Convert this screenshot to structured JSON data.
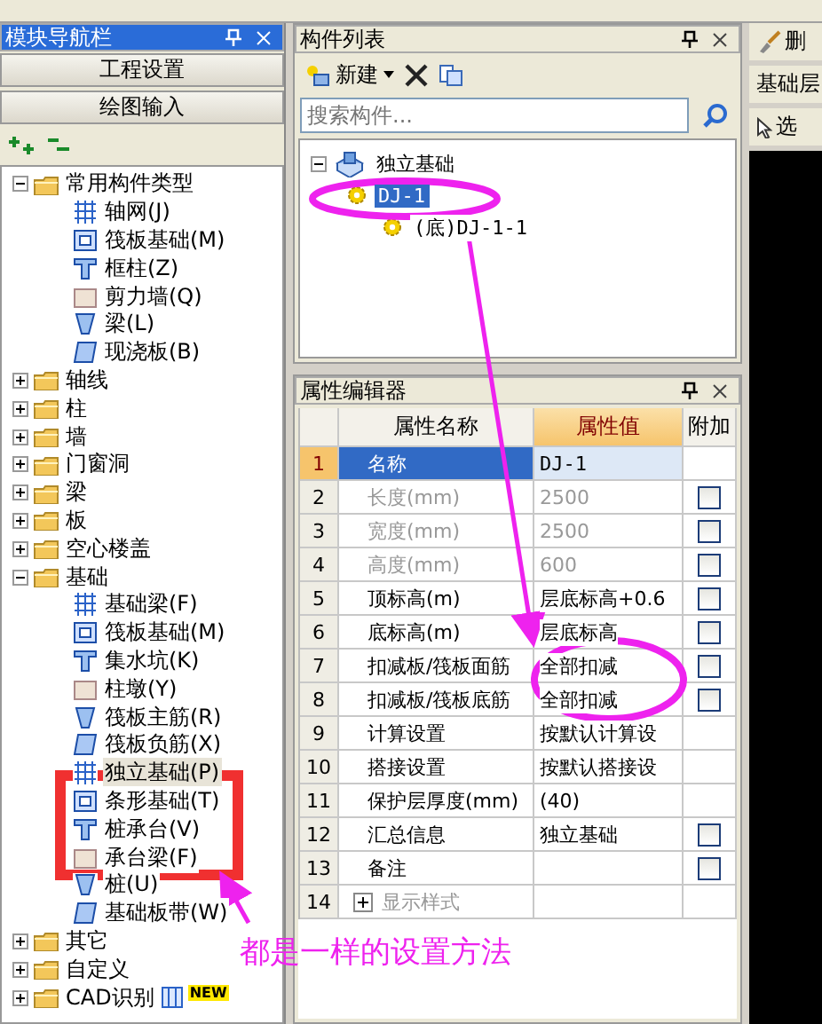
{
  "nav_panel": {
    "title": "模块导航栏",
    "buttons": [
      "工程设置",
      "绘图输入"
    ],
    "tree": [
      {
        "label": "常用构件类型",
        "expanded": true,
        "selected": false,
        "children": [
          {
            "label": "轴网(J)",
            "selected": false
          },
          {
            "label": "筏板基础(M)",
            "selected": false
          },
          {
            "label": "框柱(Z)",
            "selected": false
          },
          {
            "label": "剪力墙(Q)",
            "selected": false
          },
          {
            "label": "梁(L)",
            "selected": false
          },
          {
            "label": "现浇板(B)",
            "selected": false
          }
        ]
      },
      {
        "label": "轴线",
        "expanded": false,
        "selected": false
      },
      {
        "label": "柱",
        "expanded": false,
        "selected": false
      },
      {
        "label": "墙",
        "expanded": false,
        "selected": false
      },
      {
        "label": "门窗洞",
        "expanded": false,
        "selected": false
      },
      {
        "label": "梁",
        "expanded": false,
        "selected": false
      },
      {
        "label": "板",
        "expanded": false,
        "selected": false
      },
      {
        "label": "空心楼盖",
        "expanded": false,
        "selected": false
      },
      {
        "label": "基础",
        "expanded": true,
        "selected": false,
        "children": [
          {
            "label": "基础梁(F)",
            "selected": false
          },
          {
            "label": "筏板基础(M)",
            "selected": false
          },
          {
            "label": "集水坑(K)",
            "selected": false
          },
          {
            "label": "柱墩(Y)",
            "selected": false
          },
          {
            "label": "筏板主筋(R)",
            "selected": false
          },
          {
            "label": "筏板负筋(X)",
            "selected": false
          },
          {
            "label": "独立基础(P)",
            "selected": true
          },
          {
            "label": "条形基础(T)",
            "selected": false
          },
          {
            "label": "桩承台(V)",
            "selected": false
          },
          {
            "label": "承台梁(F)",
            "selected": false
          },
          {
            "label": "桩(U)",
            "selected": false
          },
          {
            "label": "基础板带(W)",
            "selected": false
          }
        ]
      },
      {
        "label": "其它",
        "expanded": false,
        "selected": false
      },
      {
        "label": "自定义",
        "expanded": false,
        "selected": false
      },
      {
        "label": "CAD识别",
        "expanded": false,
        "selected": false,
        "badge": "NEW"
      }
    ]
  },
  "component_list": {
    "title": "构件列表",
    "new_button": "新建",
    "search": {
      "placeholder": "搜索构件..."
    },
    "tree": [
      {
        "label": "独立基础",
        "expanded": true,
        "selected": false,
        "children": [
          {
            "label": "DJ-1",
            "selected": true,
            "children": [
              {
                "label": "(底)DJ-1-1",
                "selected": false
              }
            ]
          }
        ]
      }
    ]
  },
  "property_editor": {
    "title": "属性编辑器",
    "columns": [
      "属性名称",
      "属性值",
      "附加"
    ],
    "rows": [
      {
        "no": "1",
        "kind": "field",
        "name": "名称",
        "value": "DJ-1",
        "disabled": false,
        "selected": true
      },
      {
        "no": "2",
        "kind": "field",
        "name": "长度(mm)",
        "value": "2500",
        "disabled": true,
        "selected": false,
        "checked": false
      },
      {
        "no": "3",
        "kind": "field",
        "name": "宽度(mm)",
        "value": "2500",
        "disabled": true,
        "selected": false,
        "checked": false
      },
      {
        "no": "4",
        "kind": "field",
        "name": "高度(mm)",
        "value": "600",
        "disabled": true,
        "selected": false,
        "checked": false
      },
      {
        "no": "5",
        "kind": "field",
        "name": "顶标高(m)",
        "value": "层底标高+0.6",
        "disabled": false,
        "selected": false,
        "checked": false
      },
      {
        "no": "6",
        "kind": "field",
        "name": "底标高(m)",
        "value": "层底标高",
        "disabled": false,
        "selected": false,
        "checked": false
      },
      {
        "no": "7",
        "kind": "field",
        "name": "扣减板/筏板面筋",
        "value": "全部扣减",
        "disabled": false,
        "selected": false,
        "checked": false
      },
      {
        "no": "8",
        "kind": "field",
        "name": "扣减板/筏板底筋",
        "value": "全部扣减",
        "disabled": false,
        "selected": false,
        "checked": false
      },
      {
        "no": "9",
        "kind": "field",
        "name": "计算设置",
        "value": "按默认计算设",
        "disabled": false,
        "selected": false
      },
      {
        "no": "10",
        "kind": "field",
        "name": "搭接设置",
        "value": "按默认搭接设",
        "disabled": false,
        "selected": false
      },
      {
        "no": "11",
        "kind": "field",
        "name": "保护层厚度(mm)",
        "value": "(40)",
        "disabled": false,
        "selected": false
      },
      {
        "no": "12",
        "kind": "field",
        "name": "汇总信息",
        "value": "独立基础",
        "disabled": false,
        "selected": false,
        "checked": false
      },
      {
        "no": "13",
        "kind": "field",
        "name": "备注",
        "value": "",
        "disabled": false,
        "selected": false,
        "checked": false
      },
      {
        "no": "14",
        "kind": "group",
        "name": "显示样式",
        "value": "",
        "disabled": true,
        "selected": false,
        "expanded": false
      }
    ]
  },
  "right_toolbar": {
    "items": [
      "删",
      "基础层",
      "选"
    ]
  },
  "annotation": {
    "note": "都是一样的设置方法"
  }
}
